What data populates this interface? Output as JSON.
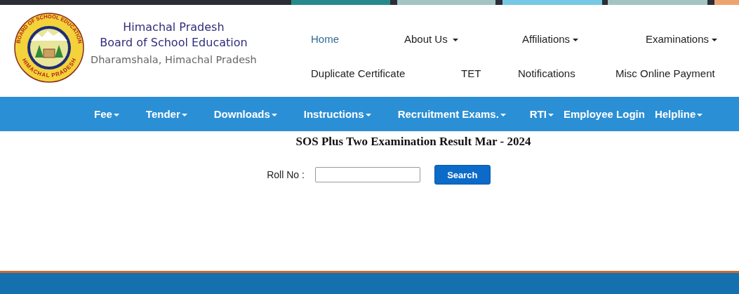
{
  "logo": {
    "ring_top": "BOARD OF SCHOOL EDUCATION",
    "ring_bottom": "HIMACHAL PRADESH"
  },
  "header": {
    "title_line_1": "Himachal Pradesh",
    "title_line_2": "Board of School Education",
    "subtitle": "Dharamshala, Himachal Pradesh"
  },
  "top_nav": [
    [
      {
        "label": "Home",
        "selected": true,
        "has_dropdown": false
      },
      {
        "label": "About Us",
        "selected": false,
        "has_dropdown": true
      },
      {
        "label": "Affiliations",
        "selected": false,
        "has_dropdown": true
      },
      {
        "label": "Examinations",
        "selected": false,
        "has_dropdown": true
      }
    ],
    [
      {
        "label": "Duplicate Certificate",
        "selected": false,
        "has_dropdown": false
      },
      {
        "label": "TET",
        "selected": false,
        "has_dropdown": false
      },
      {
        "label": "Notifications",
        "selected": false,
        "has_dropdown": false
      },
      {
        "label": "Misc Online Payment",
        "selected": false,
        "has_dropdown": false
      }
    ]
  ],
  "main_nav": [
    {
      "label": "Fee",
      "has_dropdown": true
    },
    {
      "label": "Tender",
      "has_dropdown": true
    },
    {
      "label": "Downloads",
      "has_dropdown": true
    },
    {
      "label": "Instructions",
      "has_dropdown": true
    },
    {
      "label": "Recruitment Exams.",
      "has_dropdown": true
    },
    {
      "label": "RTI",
      "has_dropdown": true
    },
    {
      "label": "Employee Login",
      "has_dropdown": false
    },
    {
      "label": "Helpline",
      "has_dropdown": true
    }
  ],
  "result_form": {
    "title": "SOS Plus Two Examination Result Mar - 2024",
    "field_label": "Roll No :",
    "search_button": "Search"
  }
}
